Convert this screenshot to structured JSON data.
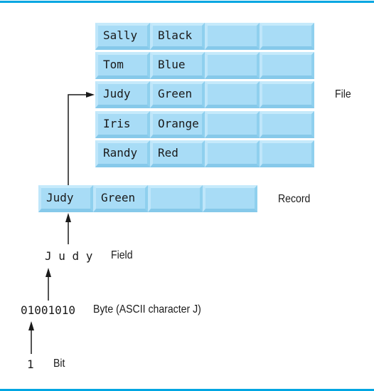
{
  "file": {
    "label": "File",
    "records": [
      {
        "fields": [
          "Sally",
          "Black",
          "",
          ""
        ]
      },
      {
        "fields": [
          "Tom",
          "Blue",
          "",
          ""
        ]
      },
      {
        "fields": [
          "Judy",
          "Green",
          "",
          ""
        ]
      },
      {
        "fields": [
          "Iris",
          "Orange",
          "",
          ""
        ]
      },
      {
        "fields": [
          "Randy",
          "Red",
          "",
          ""
        ]
      }
    ]
  },
  "record": {
    "label": "Record",
    "fields": [
      "Judy",
      "Green",
      "",
      ""
    ]
  },
  "field": {
    "value": "J u d y",
    "label": "Field"
  },
  "byte": {
    "value": "01001010",
    "label": "Byte (ASCII character J)"
  },
  "bit": {
    "value": "1",
    "label": "Bit"
  },
  "colors": {
    "rule": "#00a6e2",
    "cell": "#a8dcf6"
  }
}
